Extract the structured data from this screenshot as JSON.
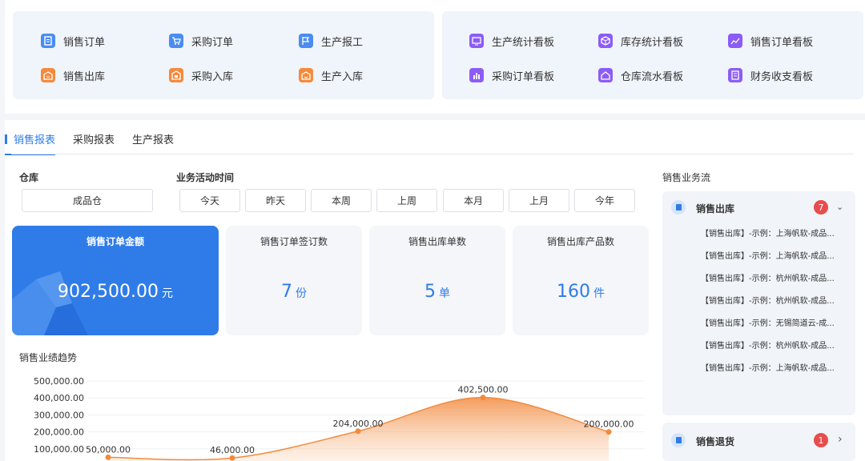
{
  "quick_left": [
    {
      "label": "销售订单",
      "icon": "document-icon",
      "color": "#4a8cf0"
    },
    {
      "label": "采购订单",
      "icon": "cart-icon",
      "color": "#4a8cf0"
    },
    {
      "label": "生产报工",
      "icon": "flag-icon",
      "color": "#4a8cf0"
    },
    {
      "label": "销售出库",
      "icon": "warehouse-out-icon",
      "color": "#f58a3c"
    },
    {
      "label": "采购入库",
      "icon": "truck-in-icon",
      "color": "#f58a3c"
    },
    {
      "label": "生产入库",
      "icon": "factory-in-icon",
      "color": "#f58a3c"
    }
  ],
  "quick_right": [
    {
      "label": "生产统计看板",
      "icon": "monitor-icon",
      "color": "#8b5cf6"
    },
    {
      "label": "库存统计看板",
      "icon": "cube-icon",
      "color": "#8b5cf6"
    },
    {
      "label": "销售订单看板",
      "icon": "line-chart-icon",
      "color": "#8b5cf6"
    },
    {
      "label": "采购订单看板",
      "icon": "bar-chart-icon",
      "color": "#8b5cf6"
    },
    {
      "label": "仓库流水看板",
      "icon": "house-icon",
      "color": "#8b5cf6"
    },
    {
      "label": "财务收支看板",
      "icon": "ledger-icon",
      "color": "#8b5cf6"
    }
  ],
  "tabs": [
    "销售报表",
    "采购报表",
    "生产报表"
  ],
  "filters": {
    "warehouse_label": "仓库",
    "warehouse_value": "成品仓",
    "time_label": "业务活动时间",
    "time_options": [
      "今天",
      "昨天",
      "本周",
      "上周",
      "本月",
      "上月",
      "今年"
    ]
  },
  "cards": [
    {
      "title": "销售订单金额",
      "value": "902,500.00",
      "unit": "元"
    },
    {
      "title": "销售订单签订数",
      "value": "7",
      "unit": "份"
    },
    {
      "title": "销售出库单数",
      "value": "5",
      "unit": "单"
    },
    {
      "title": "销售出库产品数",
      "value": "160",
      "unit": "件"
    }
  ],
  "trend_title": "销售业绩趋势",
  "chart_data": {
    "type": "area",
    "y_tick_labels": [
      "500,000.00",
      "400,000.00",
      "300,000.00",
      "200,000.00",
      "100,000.00"
    ],
    "ylim": [
      0,
      500000
    ],
    "points": [
      {
        "value": 50000,
        "label": "50,000.00"
      },
      {
        "value": 46000,
        "label": "46,000.00"
      },
      {
        "value": 204000,
        "label": "204,000.00"
      },
      {
        "value": 402500,
        "label": "402,500.00"
      },
      {
        "value": 200000,
        "label": "200,000.00"
      }
    ],
    "color": "#f28a3e"
  },
  "flow": {
    "title": "销售业务流",
    "sections": [
      {
        "label": "销售出库",
        "count": "7",
        "chevron": "chevron-down-icon",
        "items": [
          "【销售出库】-示例：上海帆软-成品...",
          "【销售出库】-示例：上海帆软-成品...",
          "【销售出库】-示例：杭州帆软-成品...",
          "【销售出库】-示例：杭州帆软-成品...",
          "【销售出库】-示例：无锡简道云-成...",
          "【销售出库】-示例：杭州帆软-成品...",
          "【销售出库】-示例：上海帆软-成品..."
        ]
      },
      {
        "label": "销售退货",
        "count": "1",
        "chevron": "chevron-right-icon",
        "items": []
      }
    ]
  },
  "colors": {
    "accent": "#2f7ce8",
    "badge": "#e84c4c"
  }
}
